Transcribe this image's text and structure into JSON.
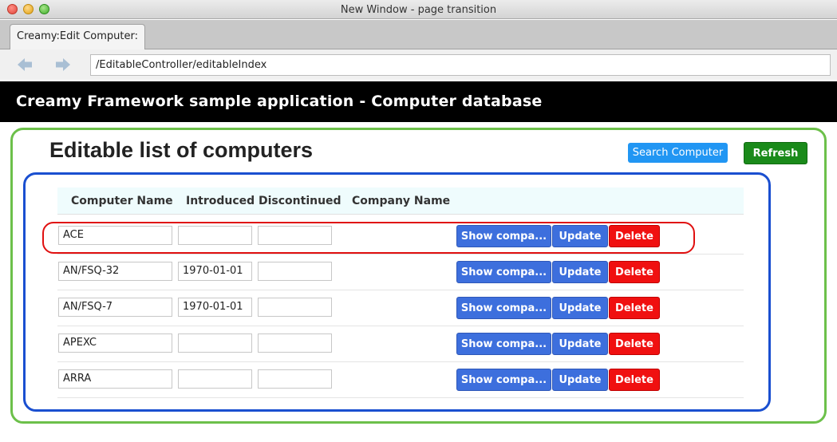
{
  "window": {
    "title": "New Window - page transition"
  },
  "tabs": [
    {
      "label": "Creamy:Edit Computer:"
    }
  ],
  "address_bar": {
    "url": "/EditableController/editableIndex"
  },
  "app_header": {
    "title": "Creamy Framework sample application - Computer database"
  },
  "page": {
    "heading": "Editable list of computers",
    "search_button": "Search Computer",
    "refresh_button": "Refresh"
  },
  "table": {
    "columns": [
      "Computer Name",
      "Introduced",
      "Discontinued",
      "Company Name"
    ],
    "rows": [
      {
        "name": "ACE",
        "introduced": "",
        "discontinued": ""
      },
      {
        "name": "AN/FSQ-32",
        "introduced": "1970-01-01",
        "discontinued": ""
      },
      {
        "name": "AN/FSQ-7",
        "introduced": "1970-01-01",
        "discontinued": ""
      },
      {
        "name": "APEXC",
        "introduced": "",
        "discontinued": ""
      },
      {
        "name": "ARRA",
        "introduced": "",
        "discontinued": ""
      }
    ],
    "show_company_label": "Show compa...",
    "update_label": "Update",
    "delete_label": "Delete"
  },
  "icons": {
    "back": "back-arrow-icon",
    "forward": "forward-arrow-icon"
  },
  "colors": {
    "highlight_green": "#6cc04a",
    "highlight_blue": "#1a4fd0",
    "highlight_red": "#e01010",
    "delete": "#f01010",
    "primary": "#3d6fdd"
  }
}
